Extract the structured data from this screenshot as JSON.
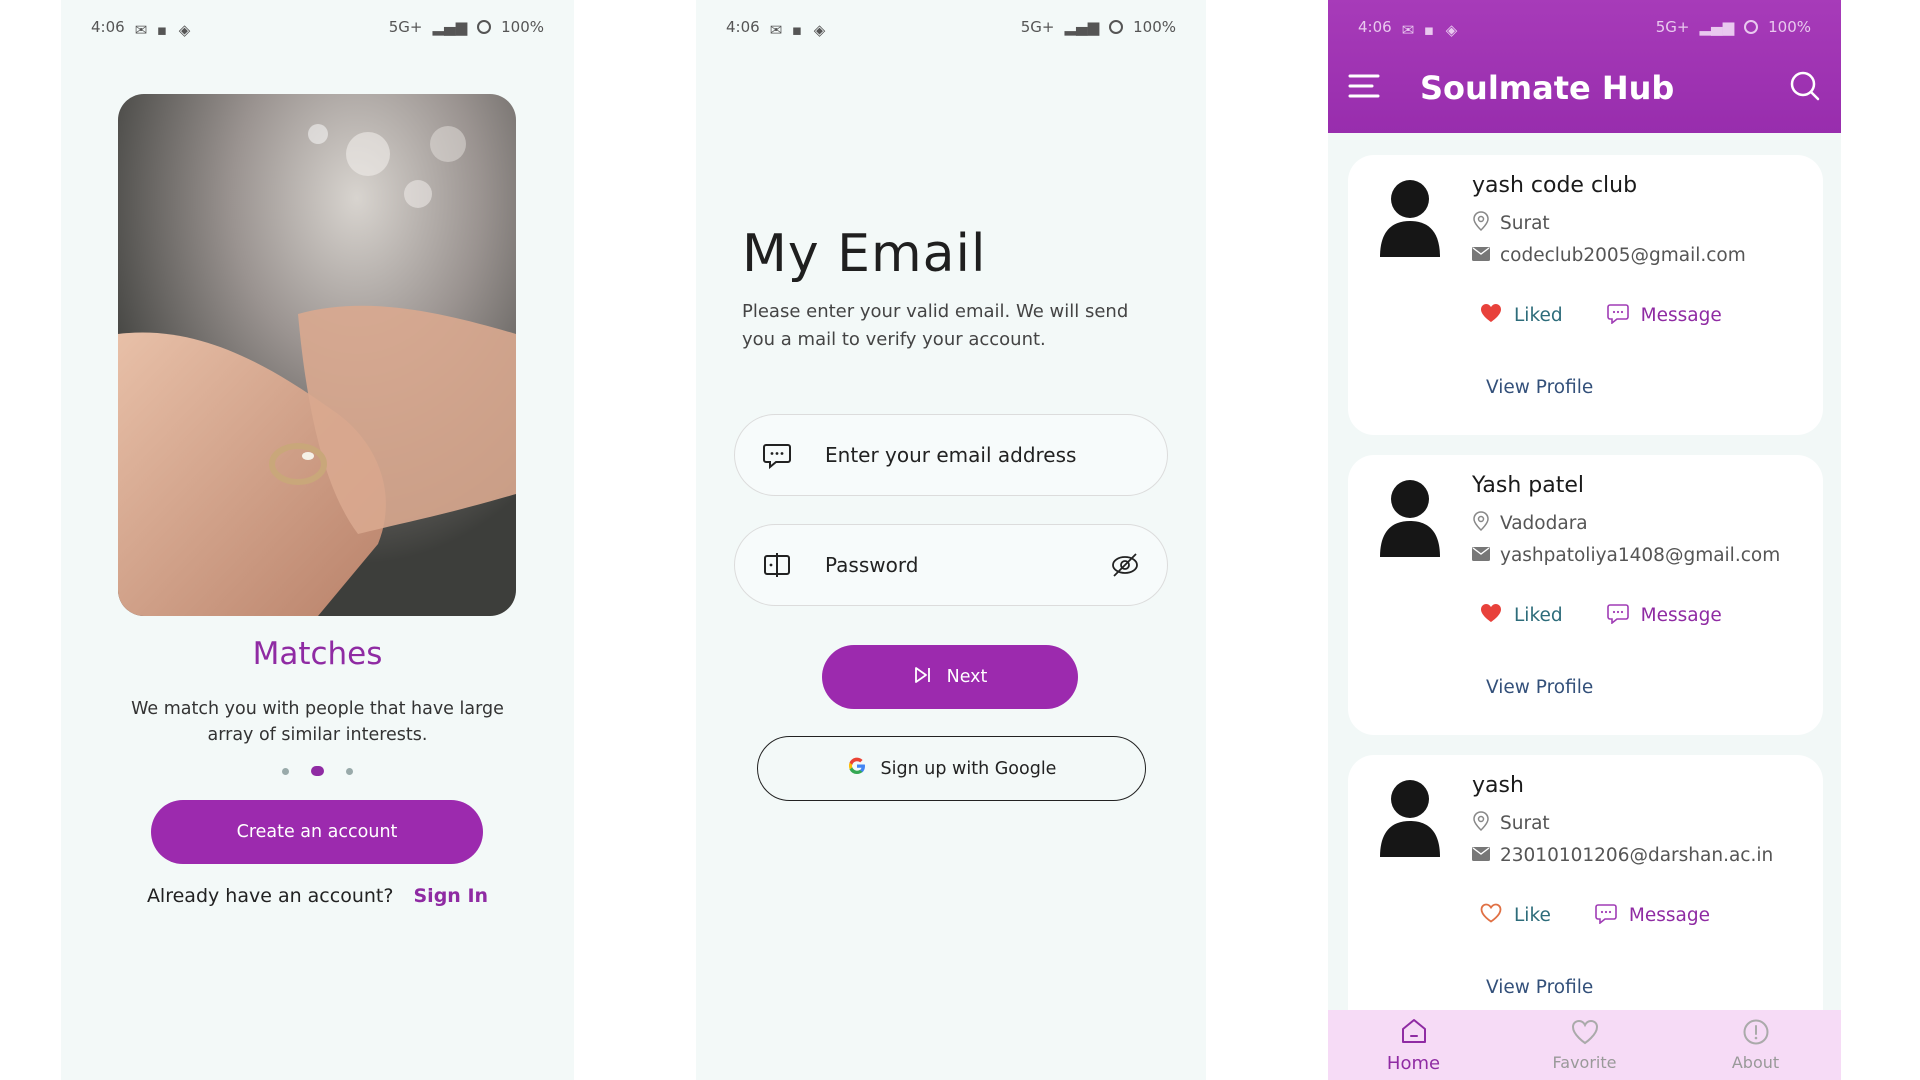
{
  "status_bar": {
    "time": "4:06",
    "battery": "100%",
    "net": "5G+"
  },
  "screen1": {
    "title": "Matches",
    "description": "We match you with people that have large array of similar interests.",
    "create_button": "Create an account",
    "signin_prompt": "Already have an account?",
    "signin_link": "Sign In",
    "page_index": 1,
    "page_count": 3
  },
  "screen2": {
    "title": "My Email",
    "description": "Please enter your valid email. We will send you a mail to verify your account.",
    "email_placeholder": "Enter your email address",
    "password_placeholder": "Password",
    "next_button": "Next",
    "google_button": "Sign up with Google"
  },
  "screen3": {
    "app_title": "Soulmate Hub",
    "cards": [
      {
        "name": "yash code club",
        "city": "Surat",
        "email": "codeclub2005@gmail.com",
        "like_label": "Liked",
        "liked": true,
        "message_label": "Message",
        "view_label": "View Profile"
      },
      {
        "name": "Yash patel",
        "city": "Vadodara",
        "email": "yashpatoliya1408@gmail.com",
        "like_label": "Liked",
        "liked": true,
        "message_label": "Message",
        "view_label": "View Profile"
      },
      {
        "name": "yash",
        "city": "Surat",
        "email": "23010101206@darshan.ac.in",
        "like_label": "Like",
        "liked": false,
        "message_label": "Message",
        "view_label": "View Profile"
      }
    ],
    "nav": {
      "home": "Home",
      "favorite": "Favorite",
      "about": "About",
      "active": "home"
    }
  },
  "colors": {
    "accent": "#9c2aae",
    "heart": "#e8413b",
    "background": "#f3f9f8"
  }
}
